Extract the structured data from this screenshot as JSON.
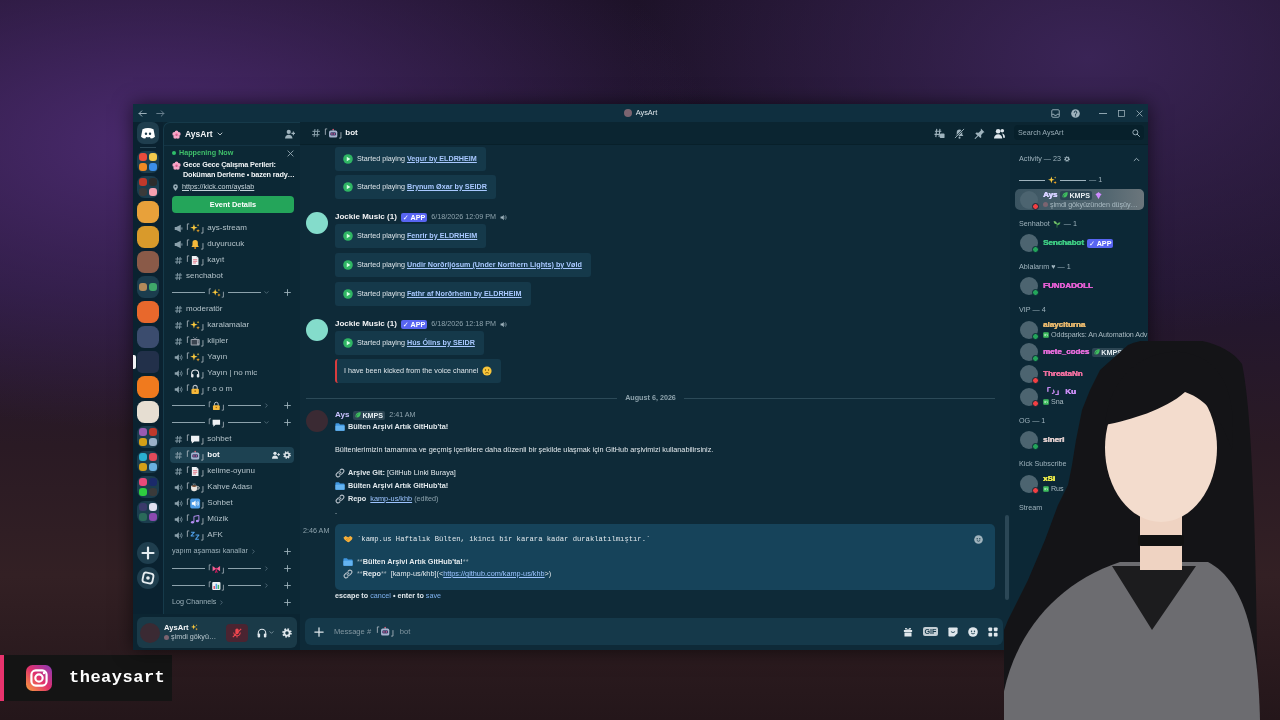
{
  "window": {
    "title": "AysArt"
  },
  "overlay": {
    "instagram": "theaysart"
  },
  "servers": [
    {
      "kind": "home",
      "selected": false
    },
    {
      "kind": "folder",
      "icons": [
        {
          "color": "#e94b3c"
        },
        {
          "color": "#f2c94c"
        },
        {
          "color": "#f08a24"
        },
        {
          "color": "#3c8ee8"
        }
      ],
      "selected": false
    },
    {
      "kind": "folder",
      "icons": [
        {
          "color": "#c0392b"
        },
        {
          "color": "#2c2c2c"
        },
        {
          "color": "#3a3a3a"
        },
        {
          "color": "#f5a0b0"
        }
      ],
      "selected": false
    },
    {
      "kind": "server",
      "color": "#e8a13a",
      "selected": false
    },
    {
      "kind": "server",
      "color": "#d99a2b",
      "selected": false
    },
    {
      "kind": "server",
      "color": "#8a5a48",
      "selected": false
    },
    {
      "kind": "folder",
      "icons": [
        {
          "color": "#b38a5a"
        },
        {
          "color": "#3fa86a"
        }
      ],
      "selected": false
    },
    {
      "kind": "server",
      "color": "#e8682c",
      "selected": false
    },
    {
      "kind": "server",
      "color": "#3b4c6e",
      "selected": false
    },
    {
      "kind": "server",
      "color": "#22304a",
      "selected": true
    },
    {
      "kind": "server",
      "color": "#f07a1e",
      "selected": false
    },
    {
      "kind": "server",
      "color": "#e6ded2",
      "selected": false
    },
    {
      "kind": "folder",
      "icons": [
        {
          "color": "#9a5ab0"
        },
        {
          "color": "#c0392b"
        },
        {
          "color": "#d4a017"
        },
        {
          "color": "#9ab0c8"
        }
      ],
      "selected": false
    },
    {
      "kind": "folder",
      "icons": [
        {
          "color": "#2ab0d0"
        },
        {
          "color": "#e04a5a"
        },
        {
          "color": "#d4a017"
        },
        {
          "color": "#6ab0e0"
        }
      ],
      "selected": false
    },
    {
      "kind": "folder",
      "icons": [
        {
          "color": "#e84a7a"
        },
        {
          "color": "#1a2a6a"
        },
        {
          "color": "#2ecc40"
        },
        {
          "color": "#3a3a3a"
        }
      ],
      "selected": false
    },
    {
      "kind": "folder",
      "icons": [
        {
          "color": "#3a3a6a"
        },
        {
          "color": "#e0e0f0"
        },
        {
          "color": "#2a6a5a"
        },
        {
          "color": "#8a4ab0"
        }
      ],
      "selected": false
    },
    {
      "kind": "add",
      "selected": false
    },
    {
      "kind": "discover",
      "selected": false
    }
  ],
  "sidebar": {
    "server_name": "AysArt",
    "event": {
      "status": "Happening Now",
      "title": "Gece Gece Çalışma Perileri: Doküman Derleme • bazen rady…",
      "location": "https://kick.com/ayslab",
      "button": "Event Details"
    },
    "channels": [
      {
        "kind": "announcement",
        "name": "ays-stream",
        "selected": false
      },
      {
        "kind": "announcement",
        "name": "duyurucuk",
        "selected": false
      },
      {
        "kind": "text",
        "name": "kayıt",
        "selected": false
      },
      {
        "kind": "text",
        "name": "senchabot",
        "selected": false
      },
      {
        "kind": "category",
        "expanded": true
      },
      {
        "kind": "text",
        "name": "moderatör",
        "selected": false
      },
      {
        "kind": "text",
        "name": "karalamalar",
        "selected": false
      },
      {
        "kind": "text",
        "name": "klipler",
        "selected": false
      },
      {
        "kind": "voice",
        "name": "Yayın",
        "selected": false
      },
      {
        "kind": "voice",
        "name": "Yayın | no mic",
        "selected": false
      },
      {
        "kind": "voice",
        "name": "r o o m",
        "selected": false
      },
      {
        "kind": "category",
        "expanded": false
      },
      {
        "kind": "category",
        "expanded": true
      },
      {
        "kind": "text",
        "name": "sohbet",
        "selected": false
      },
      {
        "kind": "text",
        "name": "bot",
        "selected": true
      },
      {
        "kind": "text",
        "name": "kelime-oyunu",
        "selected": false
      },
      {
        "kind": "voice",
        "name": "Kahve Adası",
        "selected": false
      },
      {
        "kind": "voice",
        "name": "Sohbet",
        "selected": false
      },
      {
        "kind": "voice",
        "name": "Müzik",
        "selected": false
      },
      {
        "kind": "voice",
        "name": "AFK",
        "selected": false
      },
      {
        "kind": "category",
        "name": "yapım aşaması kanallar",
        "expanded": false
      },
      {
        "kind": "category",
        "expanded": false
      },
      {
        "kind": "category",
        "expanded": false
      },
      {
        "kind": "category",
        "name": "Log Channels",
        "expanded": false
      }
    ]
  },
  "user_panel": {
    "name": "AysArt",
    "status": "şimdi gökyü…",
    "mic_muted": true
  },
  "channel_header": {
    "name": "bot"
  },
  "search": {
    "placeholder": "Search AysArt"
  },
  "messages": [
    {
      "kind": "continuation",
      "embeds": [
        {
          "kind": "playing",
          "prefix": "Started playing",
          "link": "Vegur by ELDRHEIM"
        },
        {
          "kind": "playing",
          "prefix": "Started playing",
          "link": "Brynum Øxar by SEIDR"
        }
      ]
    },
    {
      "kind": "bot",
      "author": "Jockie Music (1)",
      "tag": {
        "kind": "app",
        "text": "✓ APP"
      },
      "time": "6/18/2026 12:09 PM",
      "embeds": [
        {
          "kind": "playing",
          "prefix": "Started playing",
          "link": "Fenrir by ELDRHEIM"
        },
        {
          "kind": "playing",
          "prefix": "Started playing",
          "link": "Undir Norðrljósum (Under Northern Lights) by Vøld"
        },
        {
          "kind": "playing",
          "prefix": "Started playing",
          "link": "Fathr af Norðrheim by ELDRHEIM"
        }
      ]
    },
    {
      "kind": "bot",
      "author": "Jockie Music (1)",
      "tag": {
        "kind": "app",
        "text": "✓ APP"
      },
      "time": "6/18/2026 12:18 PM",
      "embeds": [
        {
          "kind": "playing",
          "prefix": "Started playing",
          "link": "Hús Ólins by SEIDR"
        },
        {
          "kind": "error",
          "text": "I have been kicked from the voice channel"
        }
      ]
    },
    {
      "kind": "divider",
      "text": "August 6, 2026"
    },
    {
      "kind": "user",
      "author": "Ays",
      "tag": {
        "kind": "guild",
        "text": "KMPS"
      },
      "time": "2:41 AM",
      "paragraphs": [
        [
          {
            "kind": "heading",
            "text": "Bülten Arşivi Artık GitHub'ta!"
          }
        ],
        [
          {
            "kind": "text",
            "text": "Bültenlerimizin tamamına ve geçmiş içeriklere daha düzenli bir şekilde ulaşmak için GitHub arşivimizi kullanabilirsiniz."
          }
        ],
        [
          {
            "kind": "labelled",
            "text": "**Arşive Git:** [GitHub Linki Buraya]"
          },
          {
            "kind": "heading",
            "text": "Bülten Arşivi Artık GitHub'ta!"
          },
          {
            "kind": "repo",
            "label": "Repo",
            "link": "kamp-us/khb",
            "note": "(edited)"
          },
          {
            "kind": "text",
            "text": "."
          }
        ]
      ]
    }
  ],
  "editor": {
    "time": "2:46 AM",
    "paragraphs": [
      [
        {
          "kind": "code",
          "segments": [
            {
              "kind": "plain",
              "text": "`kamp.us Haftalık Bülten, ikinci bir karara kadar duraklatılmıştır.`"
            }
          ]
        }
      ],
      [
        {
          "kind": "heading",
          "segments": [
            {
              "kind": "syntax",
              "text": "**"
            },
            {
              "kind": "bold",
              "text": "Bülten Arşivi Artık GitHub'ta!"
            },
            {
              "kind": "syntax",
              "text": "**"
            }
          ]
        },
        {
          "kind": "link",
          "segments": [
            {
              "kind": "syntax",
              "text": "**"
            },
            {
              "kind": "bold",
              "text": "Repo"
            },
            {
              "kind": "syntax",
              "text": "**"
            },
            {
              "kind": "plain",
              "text": "  [kamp-us/khb](<"
            },
            {
              "kind": "link",
              "text": "https://github.com/kamp-us/khb"
            },
            {
              "kind": "plain",
              "text": ">)"
            }
          ]
        }
      ]
    ],
    "hint": [
      {
        "kind": "bold",
        "text": "escape to "
      },
      {
        "kind": "link",
        "text": "cancel"
      },
      {
        "kind": "bold",
        "text": " • enter to "
      },
      {
        "kind": "link",
        "text": "save"
      }
    ]
  },
  "composer": {
    "placeholder": "Message #",
    "channel": "bot",
    "gif": "GIF"
  },
  "members": {
    "title": "Activity — 23",
    "expanded": true,
    "groups": [
      {
        "kind": "decorated",
        "count": "— 1",
        "members": [
          {
            "name": "Ays",
            "color": "#d6d0ff",
            "status": {
              "color": "#f23f43"
            },
            "nameplate": true,
            "boosting": true,
            "tag": {
              "kind": "guild",
              "text": "KMPS"
            },
            "activity": {
              "kind": "custom",
              "text": "şimdi gökyüzünden düşüy…"
            }
          }
        ]
      },
      {
        "kind": "named",
        "label": "Senhabot",
        "count": "— 1",
        "members": [
          {
            "name": "Senchabot",
            "color": "#3cc47f",
            "status": {
              "color": "#23a55a"
            },
            "tag": {
              "kind": "app",
              "text": "✓ APP"
            }
          }
        ]
      },
      {
        "kind": "named",
        "label": "Ablalarım ♥ — 1",
        "members": [
          {
            "name": "FUNDADOLL",
            "color": "#e35fd2",
            "status": {
              "color": "#23a55a"
            }
          }
        ]
      },
      {
        "kind": "named",
        "label": "VIP — 4",
        "members": [
          {
            "name": "alayciturna",
            "color": "#e3b56c",
            "status": {
              "color": "#23a55a"
            },
            "activity": {
              "kind": "game",
              "text": "Oddsparks: An Automation Adv"
            }
          },
          {
            "name": "mete_codes",
            "color": "#e06ad6",
            "status": {
              "color": "#23a55a"
            },
            "tag": {
              "kind": "guild",
              "text": "KMPS"
            }
          },
          {
            "name": "ThreataNn",
            "color": "#e86d9c",
            "status": {
              "color": "#f23f43"
            }
          },
          {
            "name": "「♪」 Ku",
            "color": "#c78cf2",
            "status": {
              "color": "#f23f43"
            },
            "activity": {
              "kind": "game",
              "text": "Sna"
            }
          }
        ]
      },
      {
        "kind": "named",
        "label": "OG — 1",
        "members": [
          {
            "name": "slneri",
            "color": "#dccaca",
            "status": {
              "color": "#23a55a"
            }
          }
        ]
      },
      {
        "kind": "named",
        "label": "Kick Subscribe",
        "members": [
          {
            "name": "xSi",
            "color": "#e8e84a",
            "status": {
              "color": "#f23f43"
            },
            "activity": {
              "kind": "game",
              "text": "Rus"
            }
          }
        ]
      },
      {
        "kind": "named",
        "label": "Stream"
      }
    ]
  }
}
